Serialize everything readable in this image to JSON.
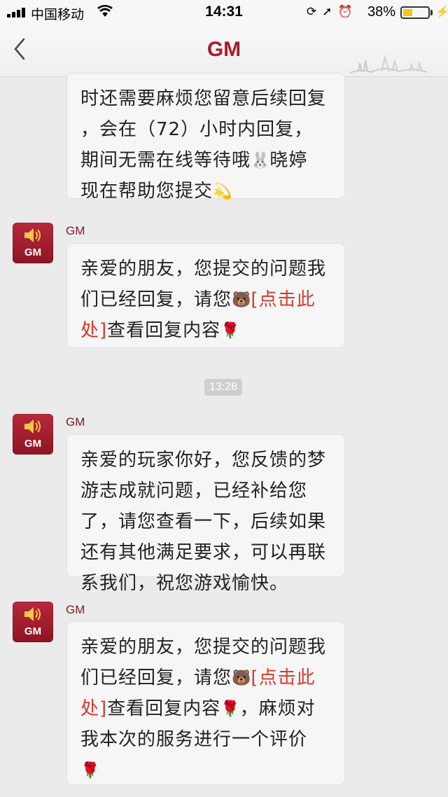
{
  "status_bar": {
    "carrier": "中国移动",
    "time": "14:31",
    "battery_percent_text": "38%",
    "battery_level": 0.38,
    "icons": [
      "signal-icon",
      "wifi-icon",
      "lock-rotation-icon",
      "location-icon",
      "alarm-icon",
      "battery-icon",
      "charging-icon"
    ]
  },
  "nav": {
    "back_icon": "chevron-left-icon",
    "title": "GM"
  },
  "colors": {
    "title": "#a51d2c",
    "avatar": "#a01f2f",
    "link": "#d63a2d",
    "bubble": "#f6f6f6",
    "background": "#ebebeb"
  },
  "messages": [
    {
      "sender": "",
      "lines": [
        "时还需要麻烦您留意后续回复",
        "，会在（72）小时内回复，",
        "期间无需在线等待哦",
        "晓婷",
        "现在帮助您提交"
      ],
      "emoji": [
        "bunny-emoji",
        "sparkle-emoji"
      ]
    },
    {
      "sender": "GM",
      "avatar_label": "GM",
      "text_before": "亲爱的朋友，您提交的问题我们已经回复，请您",
      "link": "[点击此处]",
      "text_after": "查看回复内容",
      "emoji": [
        "bear-emoji",
        "rose-emoji"
      ]
    },
    {
      "timestamp": "13:28"
    },
    {
      "sender": "GM",
      "avatar_label": "GM",
      "text": "亲爱的玩家你好，您反馈的梦游志成就问题，已经补给您了，请您查看一下，后续如果还有其他满足要求，可以再联系我们，祝您游戏愉快。"
    },
    {
      "sender": "GM",
      "avatar_label": "GM",
      "text_before": "亲爱的朋友，您提交的问题我们已经回复，请您",
      "link": "[点击此处]",
      "text_after": "查看回复内容",
      "text_tail": "，麻烦对我本次的服务进行一个评价",
      "emoji": [
        "bear-emoji",
        "rose-emoji",
        "rose-emoji"
      ]
    }
  ]
}
